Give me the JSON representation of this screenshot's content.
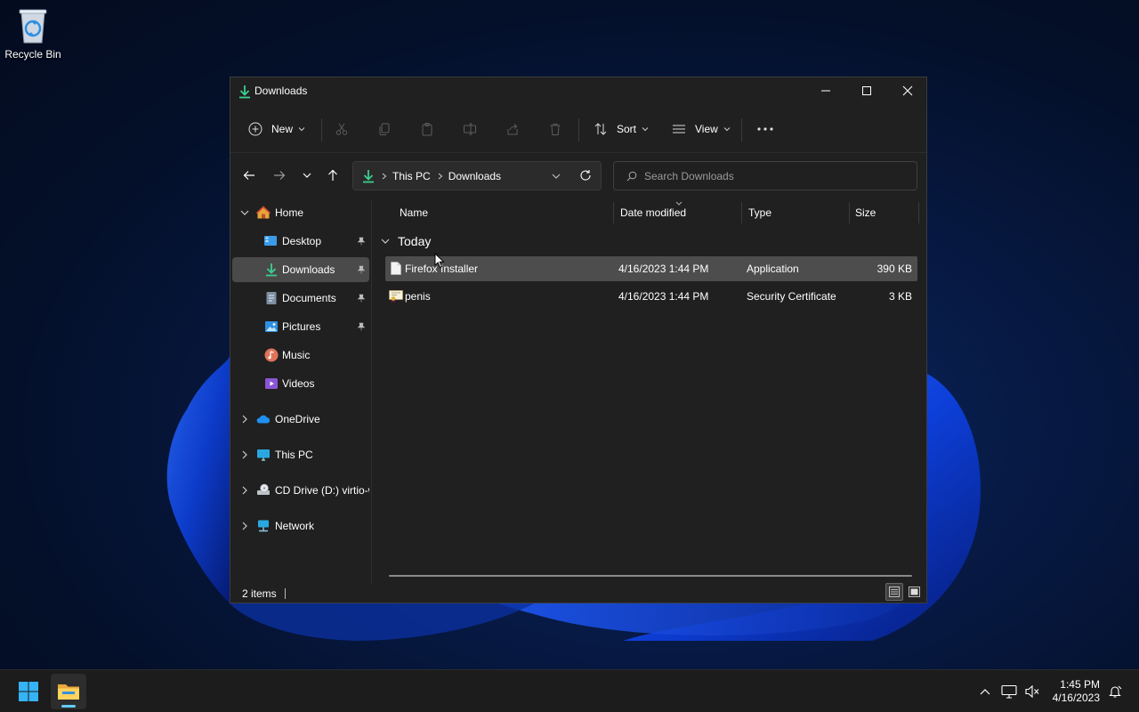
{
  "desktop": {
    "recycle_bin_label": "Recycle Bin"
  },
  "window": {
    "title": "Downloads",
    "controls": {
      "minimize": "minimize-icon",
      "maximize": "maximize-icon",
      "close": "close-icon"
    }
  },
  "toolbar": {
    "new_label": "New",
    "sort_label": "Sort",
    "view_label": "View",
    "icons": [
      "cut-icon",
      "copy-icon",
      "paste-icon",
      "rename-icon",
      "share-icon",
      "delete-icon",
      "more-icon"
    ]
  },
  "address": {
    "crumbs": [
      "This PC",
      "Downloads"
    ]
  },
  "search": {
    "placeholder": "Search Downloads"
  },
  "sidebar": {
    "home": "Home",
    "quick_access": [
      {
        "label": "Desktop",
        "pinned": true
      },
      {
        "label": "Downloads",
        "pinned": true,
        "selected": true
      },
      {
        "label": "Documents",
        "pinned": true
      },
      {
        "label": "Pictures",
        "pinned": true
      },
      {
        "label": "Music",
        "pinned": false
      },
      {
        "label": "Videos",
        "pinned": false
      }
    ],
    "roots": [
      {
        "label": "OneDrive"
      },
      {
        "label": "This PC"
      },
      {
        "label": "CD Drive (D:) virtio-win"
      },
      {
        "label": "Network"
      }
    ]
  },
  "columns": {
    "name": "Name",
    "date_modified": "Date modified",
    "type": "Type",
    "size": "Size"
  },
  "group": {
    "label": "Today"
  },
  "files": [
    {
      "name": "Firefox Installer",
      "date_modified": "4/16/2023 1:44 PM",
      "type": "Application",
      "size": "390 KB",
      "selected": true
    },
    {
      "name": "penis",
      "date_modified": "4/16/2023 1:44 PM",
      "type": "Security Certificate",
      "size": "3 KB",
      "selected": false
    }
  ],
  "status": {
    "item_count": "2 items"
  },
  "taskbar": {
    "time": "1:45 PM",
    "date": "4/16/2023"
  },
  "colors": {
    "accent": "#60cdff",
    "window_bg": "#202020",
    "selection": "#4d4d4d"
  }
}
